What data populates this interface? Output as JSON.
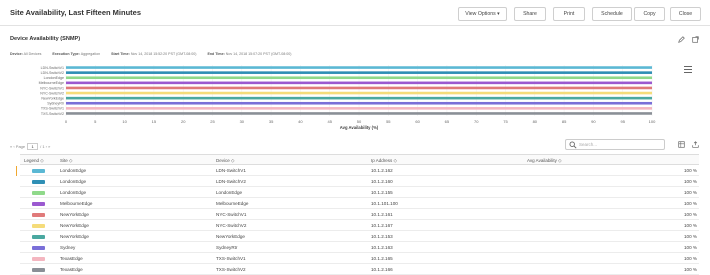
{
  "header": {
    "title": "Site Availability, Last Fifteen Minutes",
    "buttons": [
      "View Options ▾",
      "Share",
      "Print",
      "Schedule",
      "Copy",
      "Close"
    ]
  },
  "panel": {
    "title": "Device Availability (SNMP)",
    "icons": [
      "pencil-icon",
      "popout-icon"
    ],
    "meta": [
      {
        "label": "Device:",
        "value": "All Devices"
      },
      {
        "label": "Execution Type:",
        "value": "Aggregation"
      },
      {
        "label": "Start Time:",
        "value": "Nov 14, 2018 15:52:20 PST (GMT-08:00)"
      },
      {
        "label": "End Time:",
        "value": "Nov 14, 2018 15:07:20 PST (GMT-08:00)"
      }
    ]
  },
  "chart_data": {
    "type": "bar",
    "orientation": "horizontal",
    "categories": [
      "LDN-SwitchV1",
      "LDN-SwitchV2",
      "LondonEdge",
      "MelbourneEdge",
      "NYC-SwitchV1",
      "NYC-SwitchV2",
      "NewYorkEdge",
      "SydneyRtr",
      "TXS-SwitchV1",
      "TXS-SwitchV2"
    ],
    "values": [
      100,
      100,
      100,
      100,
      100,
      100,
      100,
      100,
      100,
      100
    ],
    "colors": [
      "#5bb8d4",
      "#2f8fb5",
      "#8fd98a",
      "#9b59d0",
      "#e07a7a",
      "#f5dc7a",
      "#4aa8a0",
      "#7a6fd8",
      "#f4b6c0",
      "#8a8f96"
    ],
    "xlabel": "Avg Availability (%)",
    "xlim": [
      0,
      100
    ],
    "xticks": [
      0,
      5,
      10,
      15,
      20,
      25,
      30,
      35,
      40,
      45,
      50,
      55,
      60,
      65,
      70,
      75,
      80,
      85,
      90,
      95,
      100
    ],
    "grid": true
  },
  "pager": {
    "prefix": "« ‹ Page",
    "page": "1",
    "suffix": "/ 1 › »"
  },
  "search": {
    "placeholder": "Search..."
  },
  "table": {
    "columns": [
      "Legend ◇",
      "Site ◇",
      "Device ◇",
      "Ip Address ◇",
      "Avg Availability ◇"
    ],
    "rows": [
      {
        "color": "#5bb8d4",
        "site": "LondonEdge",
        "device": "LDN-SwitchV1",
        "ip": "10.1.2.162",
        "avail": "100 %"
      },
      {
        "color": "#2f8fb5",
        "site": "LondonEdge",
        "device": "LDN-SwitchV2",
        "ip": "10.1.2.160",
        "avail": "100 %"
      },
      {
        "color": "#8fd98a",
        "site": "LondonEdge",
        "device": "LondonEdge",
        "ip": "10.1.2.155",
        "avail": "100 %"
      },
      {
        "color": "#9b59d0",
        "site": "MelbourneEdge",
        "device": "MelbourneEdge",
        "ip": "10.1.101.100",
        "avail": "100 %"
      },
      {
        "color": "#e07a7a",
        "site": "NewYorkEdge",
        "device": "NYC-SwitchV1",
        "ip": "10.1.2.161",
        "avail": "100 %"
      },
      {
        "color": "#f5dc7a",
        "site": "NewYorkEdge",
        "device": "NYC-SwitchV2",
        "ip": "10.1.2.167",
        "avail": "100 %"
      },
      {
        "color": "#4aa8a0",
        "site": "NewYorkEdge",
        "device": "NewYorkEdge",
        "ip": "10.1.2.153",
        "avail": "100 %"
      },
      {
        "color": "#7a6fd8",
        "site": "Sydney",
        "device": "SydneyRtr",
        "ip": "10.1.2.163",
        "avail": "100 %"
      },
      {
        "color": "#f4b6c0",
        "site": "TexasEdge",
        "device": "TXS-SwitchV1",
        "ip": "10.1.2.165",
        "avail": "100 %"
      },
      {
        "color": "#8a8f96",
        "site": "TexasEdge",
        "device": "TXS-SwitchV2",
        "ip": "10.1.2.166",
        "avail": "100 %"
      }
    ]
  }
}
